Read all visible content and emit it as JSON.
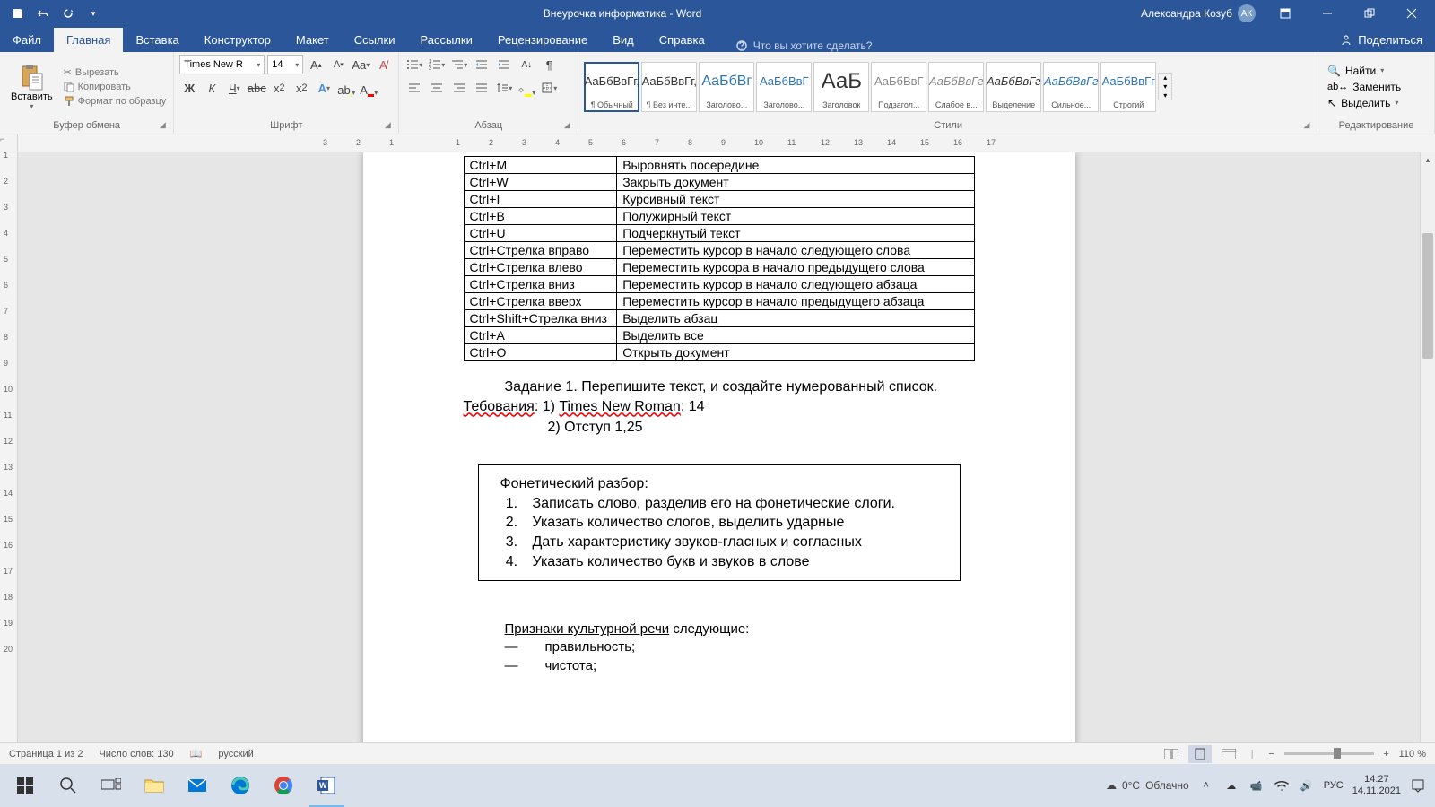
{
  "titlebar": {
    "doc_title": "Внеурочка информатика  -  Word",
    "user_name": "Александра Козуб",
    "user_initials": "АК"
  },
  "tabs": {
    "file": "Файл",
    "items": [
      "Главная",
      "Вставка",
      "Конструктор",
      "Макет",
      "Ссылки",
      "Рассылки",
      "Рецензирование",
      "Вид",
      "Справка"
    ],
    "tellme": "Что вы хотите сделать?",
    "share": "Поделиться"
  },
  "ribbon": {
    "clipboard": {
      "paste": "Вставить",
      "cut": "Вырезать",
      "copy": "Копировать",
      "format_painter": "Формат по образцу",
      "label": "Буфер обмена"
    },
    "font": {
      "name": "Times New R",
      "size": "14",
      "label": "Шрифт"
    },
    "paragraph": {
      "label": "Абзац"
    },
    "styles": {
      "label": "Стили",
      "preview": "АаБбВвГг",
      "preview_big": "АаБ",
      "items": [
        {
          "name": "¶ Обычный",
          "preview": "АаБбВвГг,"
        },
        {
          "name": "¶ Без инте...",
          "preview": "АаБбВвГг,"
        },
        {
          "name": "Заголово...",
          "preview": "АаБбВг"
        },
        {
          "name": "Заголово...",
          "preview": "АаБбВвГ"
        },
        {
          "name": "Заголовок",
          "preview": "АаБ"
        },
        {
          "name": "Подзагол...",
          "preview": "АаБбВвГ"
        },
        {
          "name": "Слабое в...",
          "preview": "АаБбВвГг"
        },
        {
          "name": "Выделение",
          "preview": "АаБбВвГг"
        },
        {
          "name": "Сильное...",
          "preview": "АаБбВвГг"
        },
        {
          "name": "Строгий",
          "preview": "АаБбВвГг"
        }
      ]
    },
    "editing": {
      "find": "Найти",
      "replace": "Заменить",
      "select": "Выделить",
      "label": "Редактирование"
    }
  },
  "ruler": {
    "h": [
      "3",
      "2",
      "1",
      "1",
      "2",
      "3",
      "4",
      "5",
      "6",
      "7",
      "8",
      "9",
      "10",
      "11",
      "12",
      "13",
      "14",
      "15",
      "16",
      "17"
    ],
    "v": [
      "1",
      "2",
      "3",
      "4",
      "5",
      "6",
      "7",
      "8",
      "9",
      "10",
      "11",
      "12",
      "13",
      "14",
      "15",
      "16",
      "17",
      "18",
      "19",
      "20"
    ]
  },
  "document": {
    "table": [
      {
        "k": "Ctrl+M",
        "v": "Выровнять посередине"
      },
      {
        "k": "Ctrl+W",
        "v": "Закрыть документ"
      },
      {
        "k": "Ctrl+I",
        "v": "Курсивный текст"
      },
      {
        "k": "Ctrl+B",
        "v": "Полужирный текст"
      },
      {
        "k": "Ctrl+U",
        "v": "Подчеркнутый текст"
      },
      {
        "k": "Ctrl+Стрелка вправо",
        "v": "Переместить курсор в начало следующего слова"
      },
      {
        "k": "Ctrl+Стрелка влево",
        "v": "Переместить курсора в начало предыдущего слова"
      },
      {
        "k": "Ctrl+Стрелка вниз",
        "v": "Переместить курсор в начало следующего абзаца"
      },
      {
        "k": "Ctrl+Стрелка вверх",
        "v": "Переместить курсор в начало предыдущего абзаца"
      },
      {
        "k": "Ctrl+Shift+Стрелка вниз",
        "v": "Выделить абзац"
      },
      {
        "k": "Ctrl+A",
        "v": "Выделить все"
      },
      {
        "k": "Ctrl+O",
        "v": "Открыть документ"
      }
    ],
    "task_line1_a": "Задание 1. Перепишите текст, и создайте нумерованный список.",
    "task_line2_a": "Тебования",
    "task_line2_b": ": 1) ",
    "task_line2_c": "Times New Roman",
    "task_line2_d": "; 14",
    "task_line3": "2) Отступ 1,25",
    "box_title": "Фонетический разбор:",
    "box_items": [
      "Записать слово, разделив его на фонетические слоги.",
      "Указать количество слогов, выделить ударные",
      "Дать характеристику звуков-гласных и согласных",
      "Указать количество букв и звуков в слове"
    ],
    "signs_title_a": "Признаки культурной речи",
    "signs_title_b": " следующие:",
    "signs_items": [
      "правильность;",
      "чистота;"
    ]
  },
  "status": {
    "page": "Страница 1 из 2",
    "words": "Число слов: 130",
    "lang": "русский",
    "zoom": "110 %"
  },
  "taskbar": {
    "weather_temp": "0°C",
    "weather_text": "Облачно",
    "lang": "РУС",
    "time": "14:27",
    "date": "14.11.2021"
  }
}
